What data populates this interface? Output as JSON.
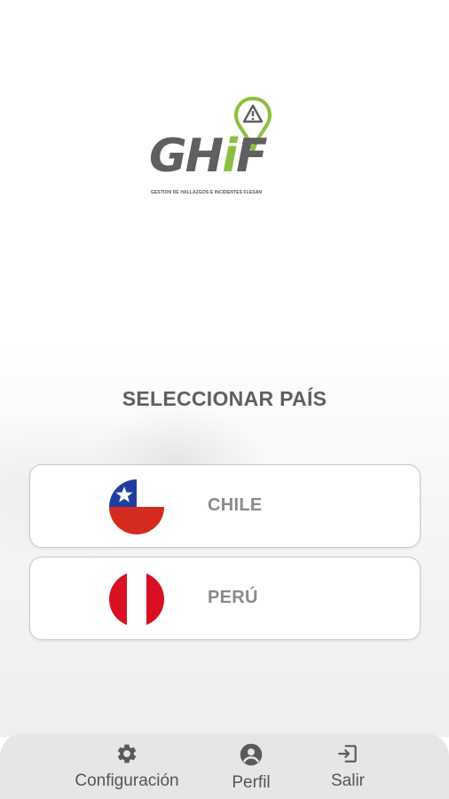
{
  "logo": {
    "word_prefix": "GH",
    "word_i": "i",
    "word_suffix": "F",
    "tagline": "GESTION DE HALLAZGOS E INCIDENTES FLESAN",
    "colors": {
      "gray": "#5f5f5f",
      "green": "#8cbf3f"
    }
  },
  "title": "SELECCIONAR PAÍS",
  "countries": [
    {
      "label": "CHILE",
      "flag": "chile-flag"
    },
    {
      "label": "PERÚ",
      "flag": "peru-flag"
    }
  ],
  "bottom_nav": [
    {
      "label": "Configuración",
      "icon": "gear-icon"
    },
    {
      "label": "Perfil",
      "icon": "profile-icon"
    },
    {
      "label": "Salir",
      "icon": "logout-icon"
    }
  ]
}
